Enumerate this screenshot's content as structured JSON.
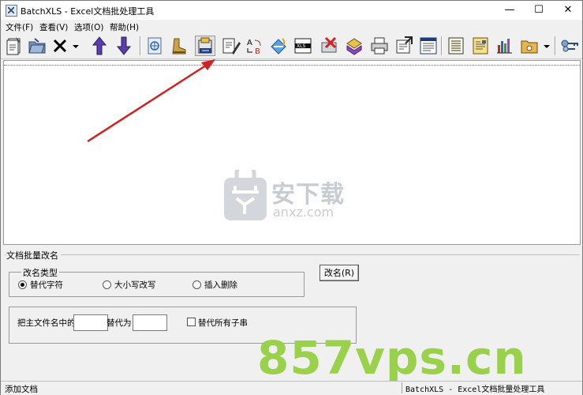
{
  "window": {
    "title": "BatchXLS - Excel文档批处理工具",
    "minimize": "—",
    "maximize": "☐",
    "close": "✕"
  },
  "menu": {
    "items": [
      "文件(F)",
      "查看(V)",
      "选项(O)",
      "帮助(H)"
    ]
  },
  "toolbar": {
    "icons": [
      "open-files-icon",
      "open-folder-icon",
      "delete-icon",
      "dropdown-icon",
      "move-up-icon",
      "move-down-icon",
      "web-icon",
      "boot-icon",
      "rename-icon",
      "edit-icon",
      "replace-icon",
      "paint-icon",
      "xls-icon",
      "remove-icon",
      "paste-icon",
      "print-icon",
      "export-icon",
      "window-icon",
      "text-list-icon",
      "document-icon",
      "chart-icon",
      "folder-settings-icon",
      "keys-icon"
    ]
  },
  "watermark": {
    "main": "安下载",
    "sub": "anxz.com",
    "footer": "857vps.cn"
  },
  "panel": {
    "title": "文档批量改名",
    "group_title": "改名类型",
    "radio": [
      "替代字符",
      "大小写改写",
      "插入删除"
    ],
    "rename_button": "改名(R)",
    "replace_prefix": "把主文件名中的",
    "replace_mid": "替代为",
    "find_value": "",
    "replace_value": "",
    "replace_all_label": "替代所有子串"
  },
  "status": {
    "left": "添加文档",
    "right": "BatchXLS - Excel文档批量处理工具"
  }
}
